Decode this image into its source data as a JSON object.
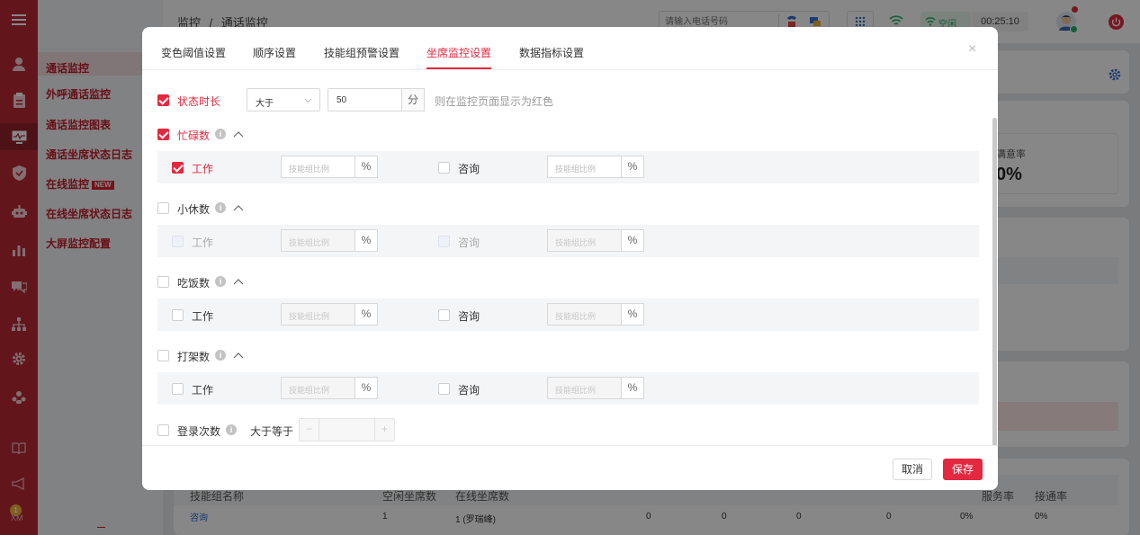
{
  "app": {
    "breadcrumb": [
      "监控",
      "通话监控"
    ],
    "breadcrumb_sep": "/",
    "search_placeholder": "请输入电话号码",
    "status_text": "空闲",
    "timer": "00:25:10",
    "avatar_badge": "1",
    "rail_bottom_text": "XM"
  },
  "subnav": {
    "items": [
      {
        "label": "通话监控",
        "active": true
      },
      {
        "label": "外呼通话监控"
      },
      {
        "label": "通话监控图表"
      },
      {
        "label": "通话坐席状态日志"
      },
      {
        "label": "在线监控",
        "badge": "NEW"
      },
      {
        "label": "在线坐席状态日志"
      },
      {
        "label": "大屏监控配置"
      }
    ]
  },
  "background": {
    "satisfaction_label": "满意率",
    "satisfaction_value": "0%",
    "table_header": {
      "queue": "技能组名称",
      "online": "空闲坐席数",
      "busy": "在线坐席数",
      "rate_a": "服务率",
      "rate_b": "接通率"
    },
    "row": {
      "name": "咨询",
      "online": "1",
      "detail": "1 (罗瑞峰)",
      "c1": "0",
      "c2": "0",
      "c3": "0",
      "c4": "0",
      "r1": "0%",
      "r2": "0%"
    }
  },
  "modal": {
    "tabs": [
      "变色阈值设置",
      "顺序设置",
      "技能组预警设置",
      "坐席监控设置",
      "数据指标设置"
    ],
    "active_tab": 3,
    "close_icon": "×",
    "status_duration": {
      "label": "状态时长",
      "checked": true,
      "compare": "大于",
      "value": "50",
      "unit": "分",
      "hint": "则在监控页面显示为红色"
    },
    "groups": [
      {
        "label": "忙碌数",
        "checked": true,
        "items": [
          {
            "label": "工作",
            "checked": true,
            "placeholder": "技能组比例",
            "suffix": "%"
          },
          {
            "label": "咨询",
            "checked": false,
            "placeholder": "技能组比例",
            "suffix": "%"
          }
        ]
      },
      {
        "label": "小休数",
        "checked": false,
        "items": [
          {
            "label": "工作",
            "checked": false,
            "placeholder": "技能组比例",
            "suffix": "%"
          },
          {
            "label": "咨询",
            "checked": false,
            "placeholder": "技能组比例",
            "suffix": "%"
          }
        ]
      },
      {
        "label": "吃饭数",
        "checked": false,
        "items": [
          {
            "label": "工作",
            "checked": false,
            "placeholder": "技能组比例",
            "suffix": "%"
          },
          {
            "label": "咨询",
            "checked": false,
            "placeholder": "技能组比例",
            "suffix": "%"
          }
        ]
      },
      {
        "label": "打架数",
        "checked": false,
        "items": [
          {
            "label": "工作",
            "checked": false,
            "placeholder": "技能组比例",
            "suffix": "%"
          },
          {
            "label": "咨询",
            "checked": false,
            "placeholder": "技能组比例",
            "suffix": "%"
          }
        ]
      }
    ],
    "login_count": {
      "label": "登录次数",
      "compare": "大于等于",
      "minus": "−",
      "plus": "+",
      "checked": false
    },
    "info_glyph": "i",
    "cancel_label": "取消",
    "save_label": "保存"
  },
  "colors": {
    "accent": "#e3283f",
    "rail": "#b92a35",
    "subnav_text": "#c41d2c"
  }
}
